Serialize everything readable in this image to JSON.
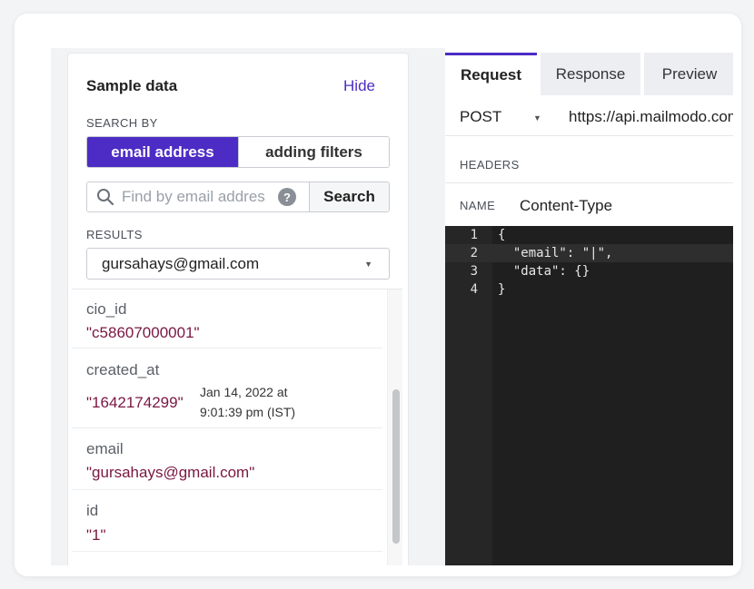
{
  "sample": {
    "title": "Sample data",
    "hide_label": "Hide",
    "search_by_label": "SEARCH BY",
    "search_modes": [
      "email address",
      "adding filters"
    ],
    "search": {
      "placeholder": "Find by email addres",
      "help_symbol": "?",
      "button_label": "Search"
    },
    "results_label": "RESULTS",
    "selected_result": "gursahays@gmail.com",
    "fields": [
      {
        "key": "cio_id",
        "value": "\"c58607000001\""
      },
      {
        "key": "created_at",
        "value": "\"1642174299\"",
        "sub_line1": "Jan 14, 2022 at",
        "sub_line2": "9:01:39 pm (IST)"
      },
      {
        "key": "email",
        "value": "\"gursahays@gmail.com\""
      },
      {
        "key": "id",
        "value": "\"1\""
      }
    ]
  },
  "request": {
    "tabs": [
      "Request",
      "Response",
      "Preview"
    ],
    "method": "POST",
    "url": "https://api.mailmodo.com",
    "headers_label": "HEADERS",
    "name_label": "NAME",
    "header_name": "Content-Type",
    "code": [
      {
        "num": "1",
        "text": "{"
      },
      {
        "num": "2",
        "text": "  \"email\": \"|\","
      },
      {
        "num": "3",
        "text": "  \"data\": {}"
      },
      {
        "num": "4",
        "text": "}"
      }
    ]
  },
  "colors": {
    "accent": "#4d2cc5",
    "value_text": "#7a1740",
    "editor_bg": "#1f1f1f"
  }
}
